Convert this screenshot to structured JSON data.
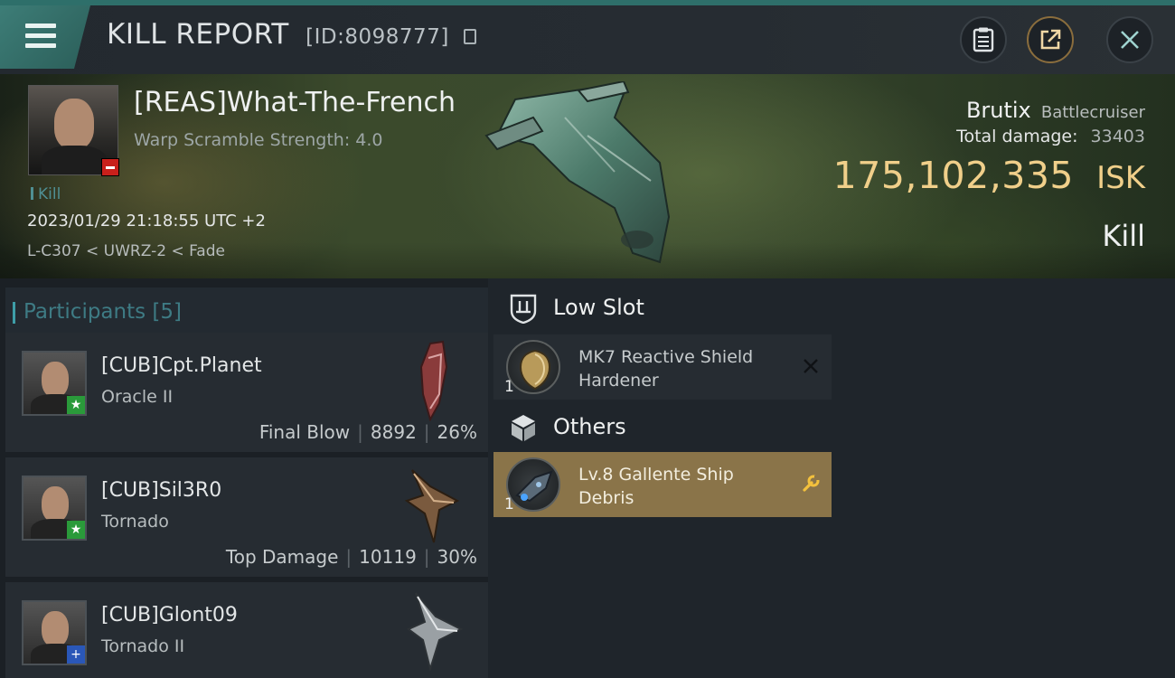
{
  "header": {
    "title": "KILL REPORT",
    "report_id": "[ID:8098777]"
  },
  "victim": {
    "name": "[REAS]What-The-French",
    "warp_scramble": "Warp Scramble Strength: 4.0",
    "tag": "Kill",
    "timestamp": "2023/01/29 21:18:55 UTC +2",
    "location": "L-C307 < UWRZ-2 < Fade",
    "ship": "Brutix",
    "ship_class": "Battlecruiser",
    "total_damage_label": "Total damage:",
    "total_damage": "33403",
    "isk_value": "175,102,335",
    "isk_unit": "ISK",
    "result": "Kill"
  },
  "participants": {
    "title": "Participants [5]",
    "items": [
      {
        "name": "[CUB]Cpt.Planet",
        "ship": "Oracle II",
        "tag": "Final Blow",
        "damage": "8892",
        "percent": "26%",
        "badge": "★",
        "badge_color": "#2a9a3a"
      },
      {
        "name": "[CUB]Sil3R0",
        "ship": "Tornado",
        "tag": "Top Damage",
        "damage": "10119",
        "percent": "30%",
        "badge": "★",
        "badge_color": "#2a9a3a"
      },
      {
        "name": "[CUB]Glont09",
        "ship": "Tornado II",
        "badge": "+",
        "badge_color": "#2a57b8"
      }
    ]
  },
  "items": {
    "low_slot": {
      "title": "Low Slot",
      "entries": [
        {
          "name": "MK7 Reactive Shield Hardener",
          "qty": "1",
          "status": "destroyed"
        }
      ]
    },
    "others": {
      "title": "Others",
      "entries": [
        {
          "name": "Lv.8 Gallente Ship Debris",
          "qty": "1",
          "status": "dropped"
        }
      ]
    }
  },
  "colors": {
    "accent": "#3e7b84",
    "isk": "#f0cf8a",
    "selected_item": "#8a7449",
    "danger": "#c8201b"
  }
}
